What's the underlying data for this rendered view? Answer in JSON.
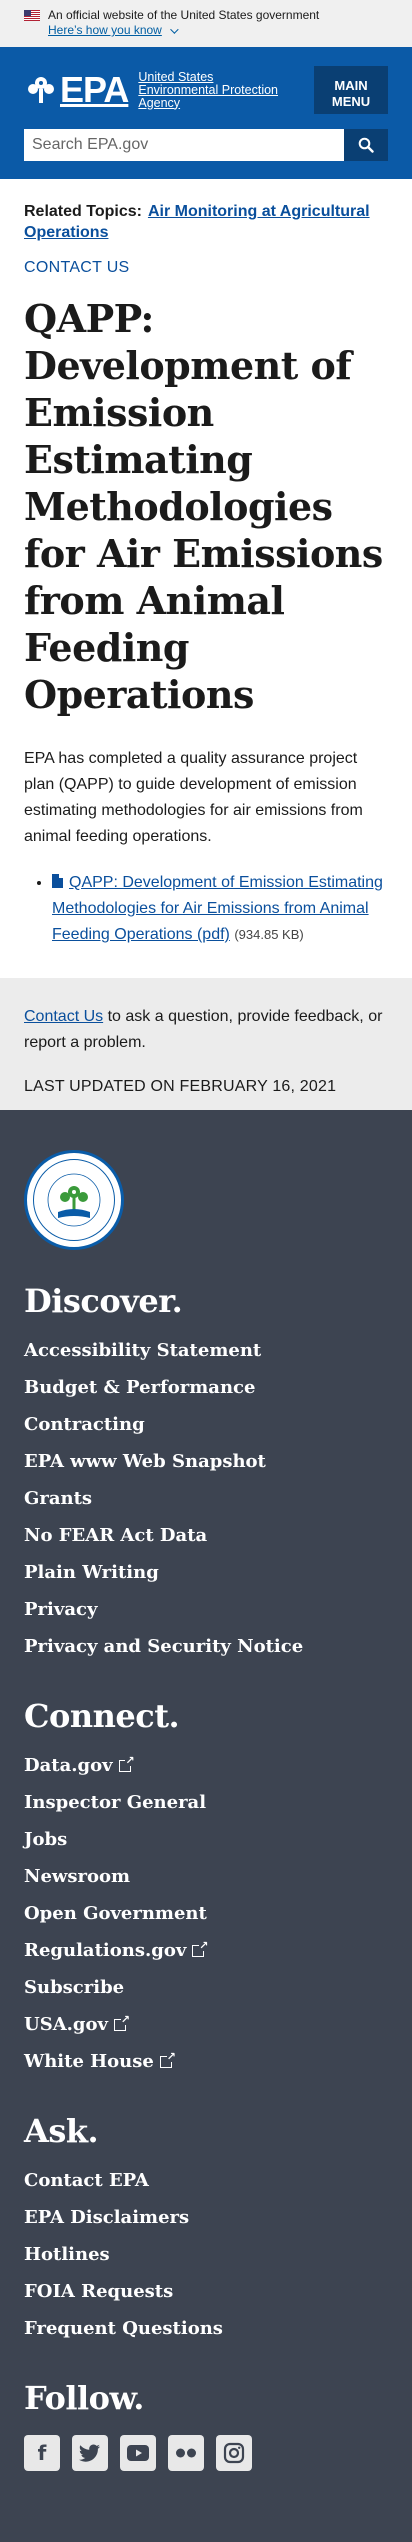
{
  "gov_banner": {
    "text": "An official website of the United States government",
    "link": "Here’s how you know"
  },
  "header": {
    "logo_abbr": "EPA",
    "logo_lines": [
      "United States",
      "Environmental Protection",
      "Agency"
    ],
    "menu_label": [
      "MAIN",
      "MENU"
    ],
    "search_placeholder": "Search EPA.gov"
  },
  "main": {
    "related_label": "Related Topics:",
    "related_link": "Air Monitoring at Agricultural Operations",
    "contact_link": "CONTACT US",
    "title": "QAPP: Development of Emission Estimating Methodologies for Air Emissions from Animal Feeding Operations",
    "intro": "EPA has completed a quality assurance project plan (QAPP) to guide development of emission estimating methodologies for air emissions from animal feeding operations.",
    "doc_link": "QAPP: Development of Emission Estimating Methodologies for Air Emissions from Animal Feeding Operations (pdf)",
    "doc_size": "(934.85 KB)"
  },
  "feedback": {
    "link": "Contact Us",
    "text": " to ask a question, provide feedback, or report a problem.",
    "updated": "LAST UPDATED ON FEBRUARY 16, 2021"
  },
  "footer": {
    "seal_text": "UNITED STATES ENVIRONMENTAL PROTECTION AGENCY",
    "discover": {
      "heading": "Discover.",
      "items": [
        "Accessibility Statement",
        "Budget & Performance",
        "Contracting",
        "EPA www Web Snapshot",
        "Grants",
        "No FEAR Act Data",
        "Plain Writing",
        "Privacy",
        "Privacy and Security Notice"
      ]
    },
    "connect": {
      "heading": "Connect.",
      "items": [
        "Data.gov",
        "Inspector General",
        "Jobs",
        "Newsroom",
        "Open Government",
        "Regulations.gov",
        "Subscribe",
        "USA.gov",
        "White House"
      ]
    },
    "ask": {
      "heading": "Ask.",
      "items": [
        "Contact EPA",
        "EPA Disclaimers",
        "Hotlines",
        "FOIA Requests",
        "Frequent Questions"
      ]
    },
    "follow": {
      "heading": "Follow.",
      "icons": [
        "facebook-icon",
        "twitter-icon",
        "youtube-icon",
        "flickr-icon",
        "instagram-icon"
      ]
    }
  },
  "colors": {
    "header_blue": "#0b5aa7",
    "link_blue": "#0a4f9c",
    "footer_bg": "#3d4451"
  }
}
